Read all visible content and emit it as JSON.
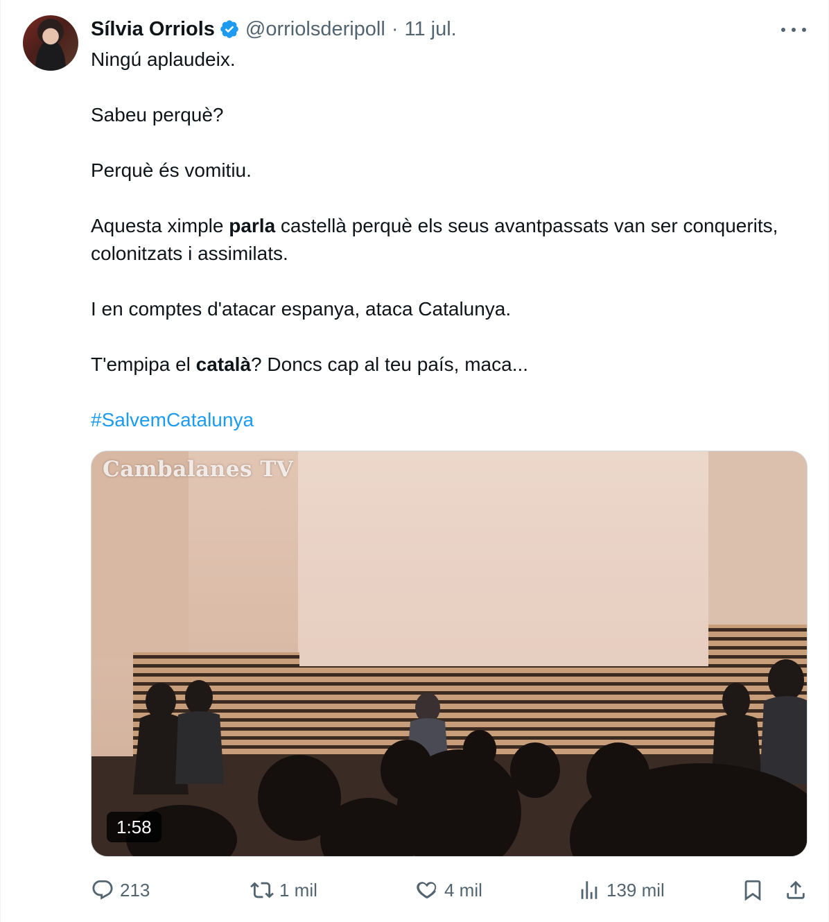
{
  "author": {
    "name": "Sílvia Orriols",
    "handle": "@orriolsderipoll",
    "separator": "·",
    "date": "11 jul."
  },
  "tweet": {
    "p1": "Ningú aplaudeix.",
    "p2": "Sabeu perquè?",
    "p3": "Perquè és vomitiu.",
    "p4_before": "Aquesta ximple ",
    "p4_bold": "parla",
    "p4_after": " castellà perquè els seus avantpassats van ser conquerits, colonitzats i assimilats.",
    "p5": "I en comptes d'atacar espanya, ataca Catalunya.",
    "p6_before": "T'empipa el ",
    "p6_bold": "català",
    "p6_after": "? Doncs cap al teu país, maca...",
    "hashtag": "#SalvemCatalunya"
  },
  "media": {
    "watermark": "Cambalanes TV",
    "duration": "1:58"
  },
  "actions": {
    "replies": "213",
    "reposts": "1 mil",
    "likes": "4 mil",
    "views": "139 mil"
  },
  "icons": [
    "verified-badge-icon",
    "more-icon",
    "reply-icon",
    "repost-icon",
    "like-icon",
    "views-icon",
    "bookmark-icon",
    "share-icon"
  ],
  "colors": {
    "accent": "#1d9bf0",
    "secondary_text": "#536471",
    "primary_text": "#0f1419"
  }
}
